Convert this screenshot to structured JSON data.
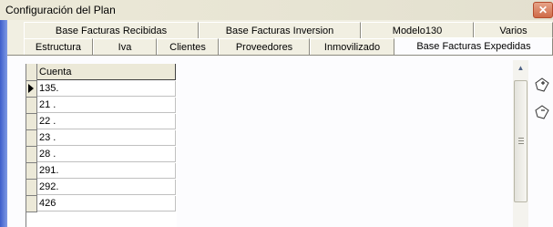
{
  "window": {
    "title": "Configuración del Plan",
    "close_label": "✕"
  },
  "tabs": {
    "row1": [
      {
        "label": "Base Facturas Recibidas"
      },
      {
        "label": "Base Facturas Inversion"
      },
      {
        "label": "Modelo130"
      },
      {
        "label": "Varios"
      }
    ],
    "row2": [
      {
        "label": "Estructura"
      },
      {
        "label": "Iva"
      },
      {
        "label": "Clientes"
      },
      {
        "label": "Proveedores"
      },
      {
        "label": "Inmovilizado"
      },
      {
        "label": "Base Facturas Expedidas",
        "active": true
      }
    ]
  },
  "grid": {
    "column_header": "Cuenta",
    "rows": [
      "135.",
      "21 .",
      "22 .",
      "23 .",
      "28 .",
      "291.",
      "292.",
      "426"
    ]
  },
  "side_buttons": [
    {
      "icon": "add-record-icon"
    },
    {
      "icon": "delete-record-icon"
    }
  ],
  "colors": {
    "frame_blue": "#3d5ecb",
    "close_red": "#cf6a48"
  }
}
